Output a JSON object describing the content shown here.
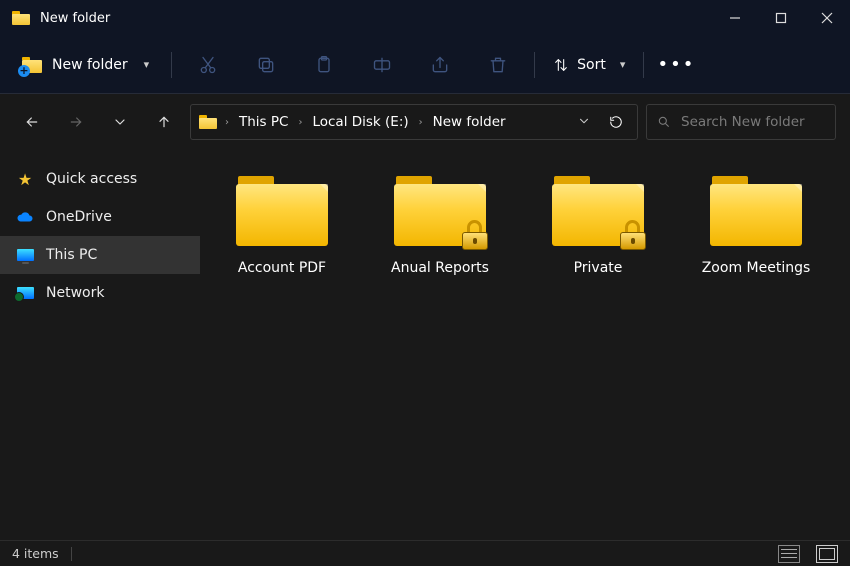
{
  "window": {
    "title": "New folder"
  },
  "toolbar": {
    "new_label": "New folder",
    "sort_label": "Sort"
  },
  "breadcrumb": {
    "items": [
      "This PC",
      "Local Disk (E:)",
      "New folder"
    ]
  },
  "search": {
    "placeholder": "Search New folder"
  },
  "sidebar": {
    "items": [
      {
        "label": "Quick access",
        "icon": "star",
        "selected": false
      },
      {
        "label": "OneDrive",
        "icon": "cloud",
        "selected": false
      },
      {
        "label": "This PC",
        "icon": "pc",
        "selected": true
      },
      {
        "label": "Network",
        "icon": "net",
        "selected": false
      }
    ]
  },
  "folders": [
    {
      "name": "Account PDF",
      "locked": false
    },
    {
      "name": "Anual Reports",
      "locked": true
    },
    {
      "name": "Private",
      "locked": true
    },
    {
      "name": "Zoom Meetings",
      "locked": false
    }
  ],
  "status": {
    "count_text": "4 items"
  }
}
